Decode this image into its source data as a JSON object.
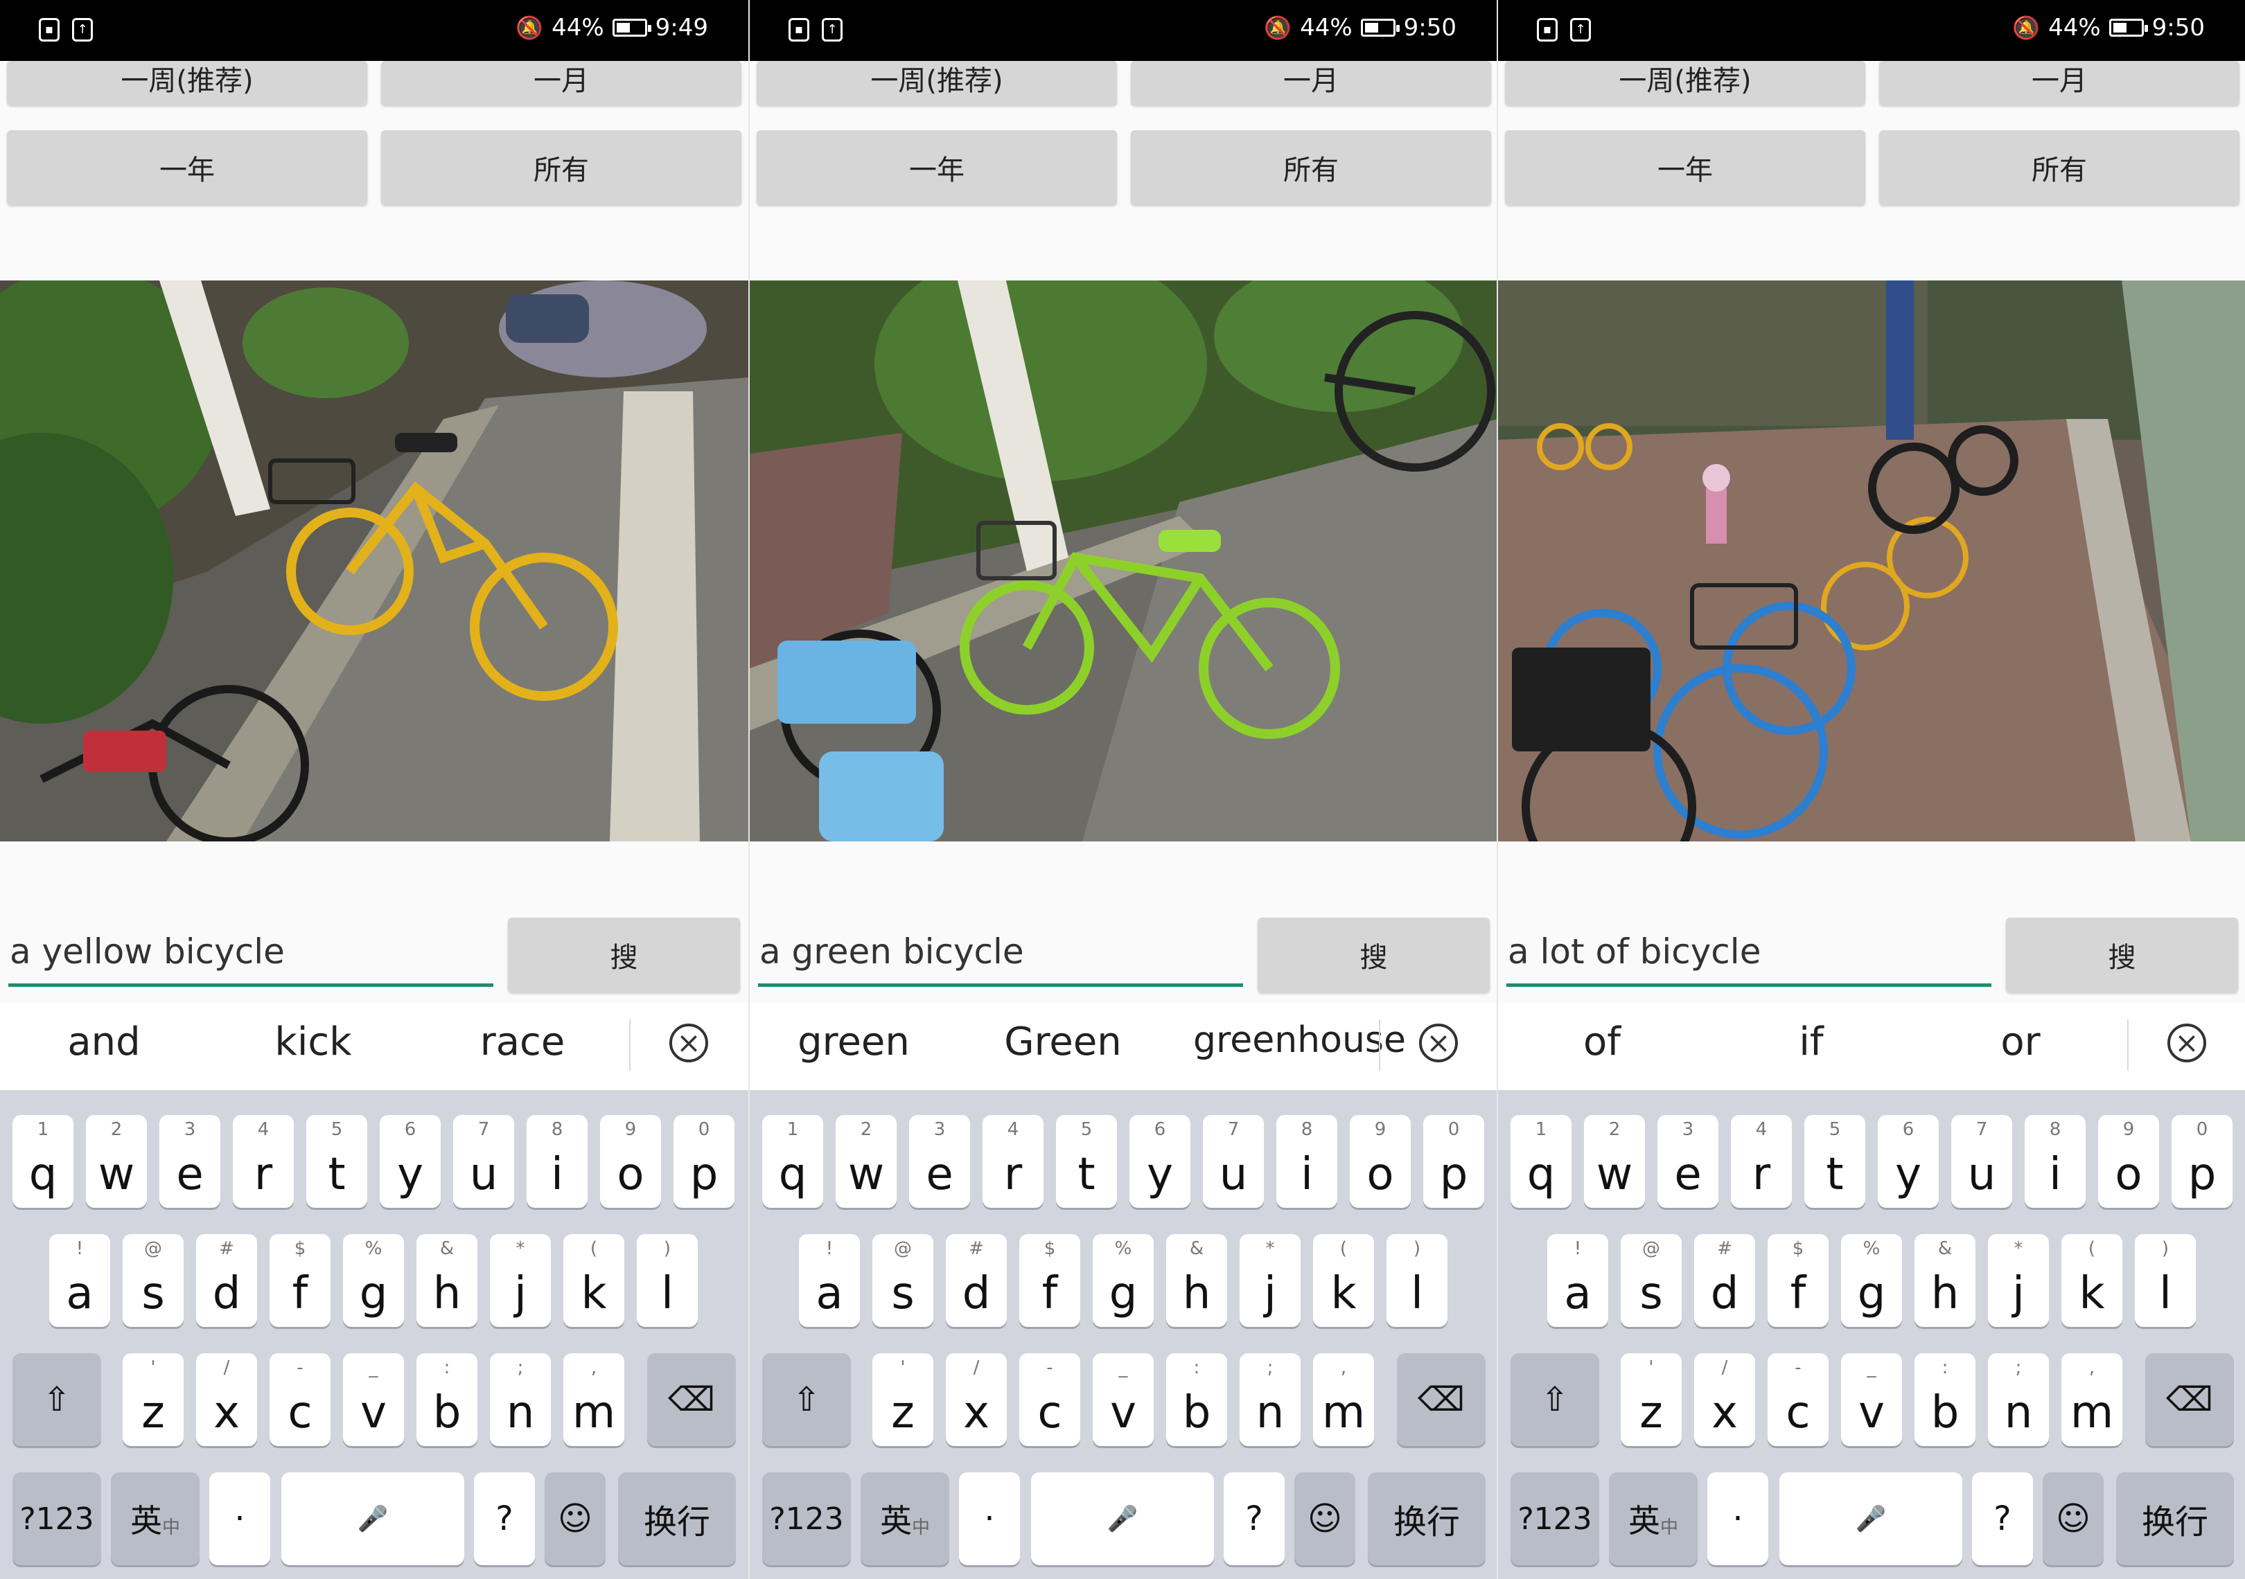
{
  "panels": [
    {
      "status": {
        "battery": "44%",
        "time": "9:49"
      },
      "buttons": {
        "week": "一周(推荐)",
        "month": "一月",
        "year": "一年",
        "all": "所有"
      },
      "query": "a yellow bicycle",
      "search_label": "搜",
      "suggestions": [
        "and",
        "kick",
        "race"
      ]
    },
    {
      "status": {
        "battery": "44%",
        "time": "9:50"
      },
      "buttons": {
        "week": "一周(推荐)",
        "month": "一月",
        "year": "一年",
        "all": "所有"
      },
      "query": "a green bicycle",
      "search_label": "搜",
      "suggestions": [
        "green",
        "Green",
        "greenhouse"
      ]
    },
    {
      "status": {
        "battery": "44%",
        "time": "9:50"
      },
      "buttons": {
        "week": "一周(推荐)",
        "month": "一月",
        "year": "一年",
        "all": "所有"
      },
      "query": "a lot of bicycle",
      "search_label": "搜",
      "suggestions": [
        "of",
        "if",
        "or"
      ]
    }
  ],
  "keyboard": {
    "row1": [
      [
        "q",
        "1"
      ],
      [
        "w",
        "2"
      ],
      [
        "e",
        "3"
      ],
      [
        "r",
        "4"
      ],
      [
        "t",
        "5"
      ],
      [
        "y",
        "6"
      ],
      [
        "u",
        "7"
      ],
      [
        "i",
        "8"
      ],
      [
        "o",
        "9"
      ],
      [
        "p",
        "0"
      ]
    ],
    "row2": [
      [
        "a",
        "!"
      ],
      [
        "s",
        "@"
      ],
      [
        "d",
        "#"
      ],
      [
        "f",
        "$"
      ],
      [
        "g",
        "%"
      ],
      [
        "h",
        "&"
      ],
      [
        "j",
        "*"
      ],
      [
        "k",
        "("
      ],
      [
        "l",
        ")"
      ]
    ],
    "row3": [
      [
        "z",
        "'"
      ],
      [
        "x",
        "/"
      ],
      [
        "c",
        "-"
      ],
      [
        "v",
        "_"
      ],
      [
        "b",
        ":"
      ],
      [
        "n",
        ";"
      ],
      [
        "m",
        ","
      ]
    ],
    "num_label": "?123",
    "lang_label": "英",
    "lang_sub": "中",
    "dot_label": "·",
    "question_label": "?",
    "enter_label": "换行"
  },
  "colors": {
    "accent": "#1f8c70",
    "keyboard_bg": "#d2d5dd",
    "button_bg": "#d6d6d6"
  },
  "icons": [
    "sim-icon",
    "upload-icon",
    "mute-bell-icon",
    "battery-icon",
    "clear-icon",
    "shift-icon",
    "backspace-icon",
    "mic-icon",
    "emoji-icon"
  ]
}
